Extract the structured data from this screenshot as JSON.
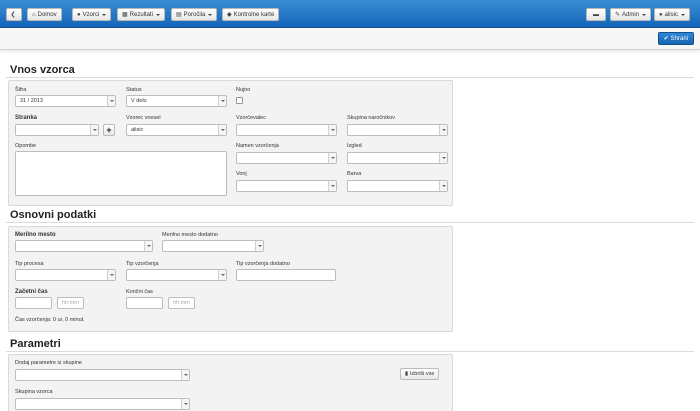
{
  "navbar": {
    "back_icon": "chevron-left-icon",
    "home": {
      "label": "Domov",
      "icon": "home-icon"
    },
    "vzorci": {
      "label": "Vzorci",
      "icon": "drop-icon"
    },
    "rezultati": {
      "label": "Rezultati",
      "icon": "table-icon"
    },
    "porocila": {
      "label": "Poročila",
      "icon": "document-icon"
    },
    "kontrolne": {
      "label": "Kontrolne karte",
      "icon": "tag-icon"
    },
    "comment_icon": "comment-icon",
    "admin": {
      "label": "Admin",
      "icon": "wrench-icon"
    },
    "user": {
      "label": "alisic",
      "icon": "user-icon"
    }
  },
  "toolbar": {
    "save_label": "Shrani",
    "save_icon": "check-icon"
  },
  "vnos": {
    "title": "Vnos vzorca",
    "sifra_label": "Šifra",
    "sifra_value": "31 / 2013",
    "status_label": "Status",
    "status_value": "V delu",
    "nujno_label": "Nujno",
    "stranka_label": "Stranka",
    "vnesel_label": "Vzorec vnesel",
    "vnesel_value": "alisic",
    "vzorcevalec_label": "Vzorčevalec",
    "skupina_label": "Skupina naročnikov",
    "opombe_label": "Opombe",
    "namen_label": "Namen vzorčenja",
    "izgled_label": "Izgled",
    "vonj_label": "Vonj",
    "barva_label": "Barva"
  },
  "osnovni": {
    "title": "Osnovni podatki",
    "merilno_label": "Merilno mesto",
    "merilno_dod_label": "Merilno mesto dodatno",
    "tip_procesa_label": "Tip procesa",
    "tip_vz_label": "Tip vzorčenja",
    "tip_vz_dod_label": "Tip vzorčenja dodatno",
    "zacetni_label": "Začetni čas",
    "koncni_label": "Končni čas",
    "time_placeholder": "hh:mm",
    "cas_text": "Čas vzorčenja: 0 ur, 0 minut."
  },
  "parametri": {
    "title": "Parametri",
    "dodaj_label": "Dodaj parametre iz skupine",
    "izbrisi_label": "Izbriši vse",
    "izbrisi_icon": "trash-icon",
    "skupina_label": "Skupina vzorca"
  }
}
